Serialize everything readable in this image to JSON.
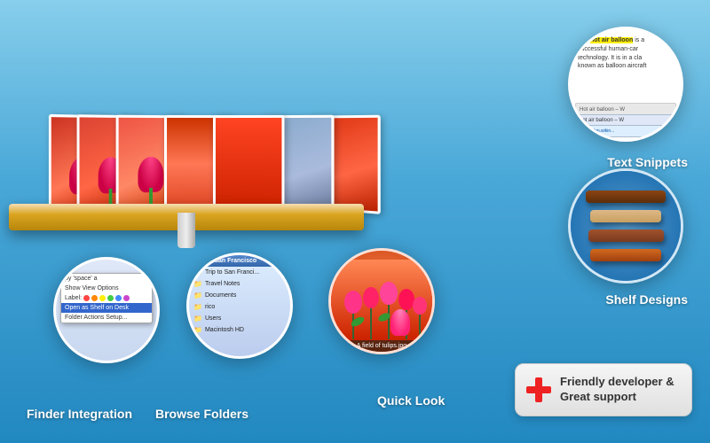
{
  "features": {
    "text_snippets": {
      "label": "Text Snippets",
      "snippet_text": "The hot air balloon is a successful human-car technology. It is in a cla known as balloon aircraft",
      "url_bar_text": "Hot air balloon – W",
      "link_text": "↵ http://en.wikin..."
    },
    "shelf_designs": {
      "label": "Shelf Designs"
    },
    "quick_look": {
      "label": "Quick Look",
      "image_caption": "A field of tulips.jpg"
    },
    "finder_integration": {
      "label": "Finder Integration",
      "menu_item_1": "py 'space' a",
      "menu_item_2": "Show View Options",
      "label_text": "Label:",
      "item_open": "Open as Shelf on Desk",
      "item_folder": "Folder Actions Setup..."
    },
    "browse_folders": {
      "label": "Browse Folders",
      "header": "Trip to San Francisco",
      "items": [
        "Trip to San Franci...",
        "Travel Notes",
        "Documents",
        "rico",
        "Users",
        "Macintosh HD"
      ]
    }
  },
  "support": {
    "label": "Friendly developer &\nGreat support",
    "line1": "Friendly developer &",
    "line2": "Great support"
  }
}
